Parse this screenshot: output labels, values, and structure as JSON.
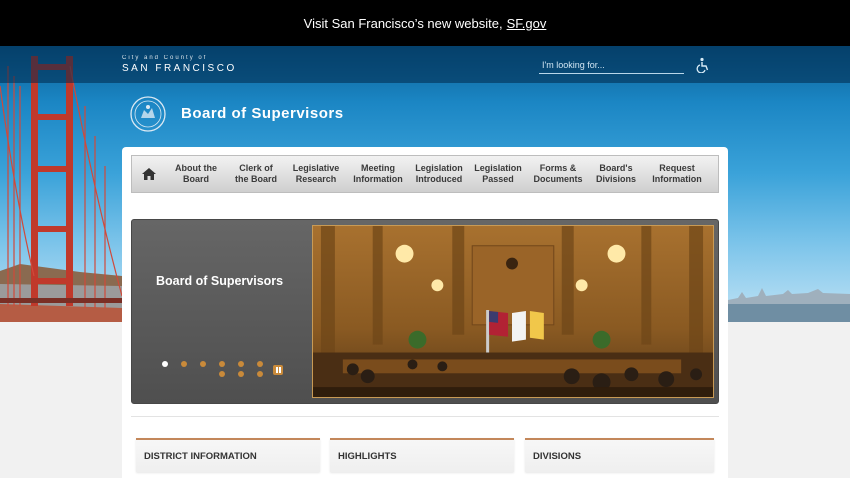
{
  "banner": {
    "text": "Visit San Francisco’s new website,",
    "link": "SF.gov"
  },
  "header": {
    "city_small": "City and County of",
    "city_big": "SAN FRANCISCO",
    "search_placeholder": "I'm looking for...",
    "accessibility_icon": "wheelchair-icon"
  },
  "site": {
    "title": "Board of Supervisors",
    "seal_icon": "city-seal-icon"
  },
  "nav": {
    "home_icon": "home-icon",
    "items": [
      {
        "line1": "About the",
        "line2": "Board"
      },
      {
        "line1": "Clerk of",
        "line2": "the Board"
      },
      {
        "line1": "Legislative",
        "line2": "Research"
      },
      {
        "line1": "Meeting",
        "line2": "Information"
      },
      {
        "line1": "Legislation",
        "line2": "Introduced"
      },
      {
        "line1": "Legislation",
        "line2": "Passed"
      },
      {
        "line1": "Forms &",
        "line2": "Documents"
      },
      {
        "line1": "Board's",
        "line2": "Divisions"
      },
      {
        "line1": "Request",
        "line2": "Information"
      }
    ]
  },
  "slider": {
    "caption": "Board of Supervisors",
    "slide_count": 10,
    "active_slide": 1,
    "pause_icon": "pause-icon"
  },
  "sections": [
    {
      "title": "DISTRICT INFORMATION"
    },
    {
      "title": "HIGHLIGHTS"
    },
    {
      "title": "DIVISIONS"
    }
  ],
  "colors": {
    "accent": "#c98a3a",
    "banner_bg": "#000000",
    "sky_top": "#0b5f94"
  }
}
